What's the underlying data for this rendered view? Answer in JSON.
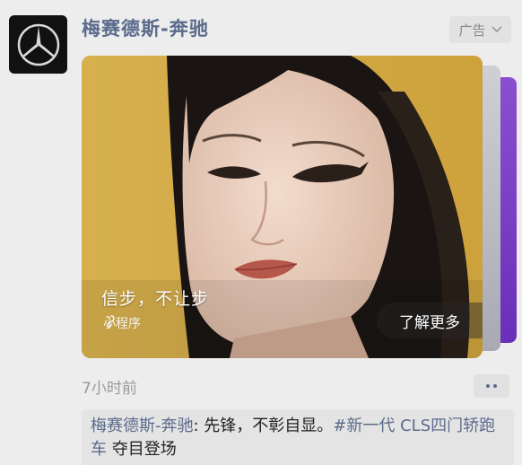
{
  "account": {
    "name": "梅赛德斯-奔驰",
    "avatar_icon": "mercedes-star-logo"
  },
  "ad_badge": {
    "label": "广告",
    "icon": "chevron-down-icon"
  },
  "card": {
    "slogan": "信步，不让步",
    "mini_program": "小程序",
    "mini_program_icon": "mini-program-icon",
    "learn_more": "了解更多",
    "background_color": "#d9b24c"
  },
  "post": {
    "time": "7小时前",
    "more_icon": "more-dots-icon"
  },
  "comment": {
    "author": "梅赛德斯-奔驰",
    "separator": ": ",
    "text": "先锋，不彰自显。",
    "hashtag": "#新一代 CLS四门轿跑车",
    "suffix": " 夺目登场"
  },
  "colors": {
    "link": "#5b6b8c",
    "page_bg": "#ededed"
  }
}
